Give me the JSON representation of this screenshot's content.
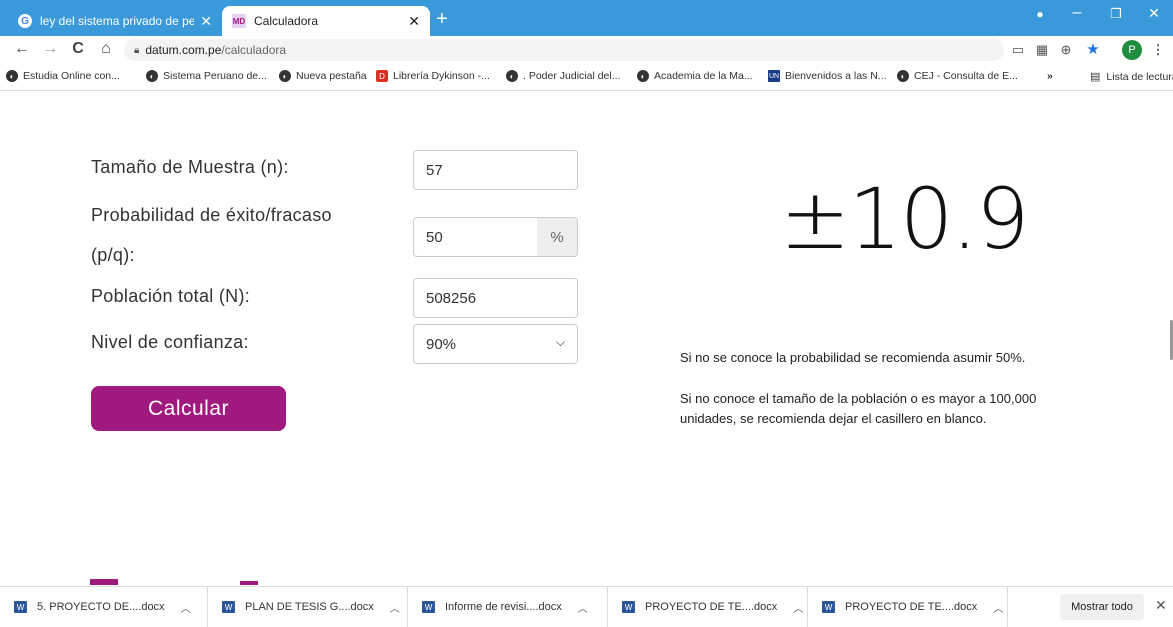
{
  "browser": {
    "tabs": [
      {
        "title": "ley del sistema privado de pensio",
        "favicon": "G",
        "close": "✕"
      },
      {
        "title": "Calculadora",
        "favicon": "MD",
        "close": "✕"
      }
    ],
    "new_tab": "+",
    "url_host": "datum.com.pe",
    "url_path": "/calculadora",
    "profile_initial": "P",
    "bookmarks": [
      {
        "label": "Estudia Online con..."
      },
      {
        "label": "Sistema Peruano de..."
      },
      {
        "label": "Nueva pestaña"
      },
      {
        "label": "Librería Dykinson -..."
      },
      {
        "label": ". Poder Judicial del..."
      },
      {
        "label": "Academia de la Ma..."
      },
      {
        "label": "Bienvenidos a las N..."
      },
      {
        "label": "CEJ - Consulta de E..."
      }
    ],
    "bookmarks_more": "»",
    "reading_list": "Lista de lectura"
  },
  "calculator": {
    "sample_size_label": "Tamaño de Muestra (n):",
    "sample_size_value": "57",
    "probability_label_line1": "Probabilidad de éxito/fracaso",
    "probability_label_line2": "(p/q):",
    "probability_value": "50",
    "probability_unit": "%",
    "population_label": "Población total (N):",
    "population_value": "508256",
    "confidence_label": "Nivel de confianza:",
    "confidence_value": "90%",
    "calculate_button": "Calcular",
    "result": "±10.9",
    "note1": "Si no se conoce la probabilidad se recomienda asumir 50%.",
    "note2": "Si no conoce el tamaño de la población o es mayor a 100,000 unidades, se recomienda dejar el casillero en blanco.",
    "accent_color": "#a0197f"
  },
  "downloads": {
    "items": [
      {
        "name": "5. PROYECTO DE....docx"
      },
      {
        "name": "PLAN DE TESIS G....docx"
      },
      {
        "name": "Informe de revisi....docx"
      },
      {
        "name": "PROYECTO DE TE....docx"
      },
      {
        "name": "PROYECTO DE TE....docx"
      }
    ],
    "show_all": "Mostrar todo",
    "close": "✕"
  }
}
